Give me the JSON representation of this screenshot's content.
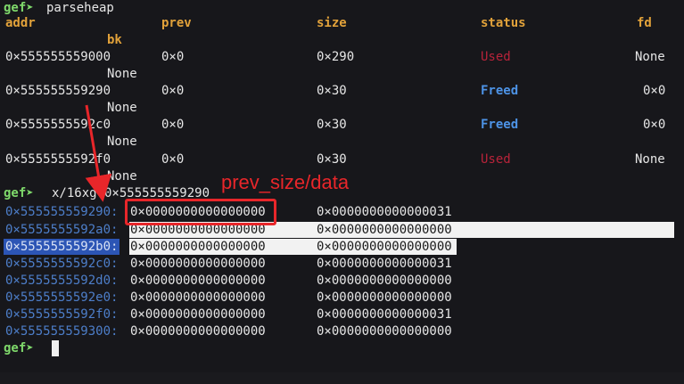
{
  "prompt": "gef➤",
  "commands": {
    "parseheap": "parseheap",
    "examine": "x/16xg 0×555555559290"
  },
  "heap_table": {
    "headers": {
      "addr": "addr",
      "prev": "prev",
      "size": "size",
      "status": "status",
      "fd": "fd",
      "bk": "bk"
    },
    "rows": [
      {
        "addr": "0×555555559000",
        "prev": "0×0",
        "size": "0×290",
        "status": "Used",
        "fd": "None",
        "bk": "None"
      },
      {
        "addr": "0×555555559290",
        "prev": "0×0",
        "size": "0×30",
        "status": "Freed",
        "fd": "0×0",
        "bk": "None"
      },
      {
        "addr": "0×5555555592c0",
        "prev": "0×0",
        "size": "0×30",
        "status": "Freed",
        "fd": "0×0",
        "bk": "None"
      },
      {
        "addr": "0×5555555592f0",
        "prev": "0×0",
        "size": "0×30",
        "status": "Used",
        "fd": "None",
        "bk": "None"
      }
    ]
  },
  "memory_dump": [
    {
      "addr": "0×555555559290:",
      "v1": "0×0000000000000000",
      "v2": "0×0000000000000031"
    },
    {
      "addr": "0×5555555592a0:",
      "v1": "0×0000000000000000",
      "v2": "0×0000000000000000"
    },
    {
      "addr": "0×5555555592b0:",
      "v1": "0×0000000000000000",
      "v2": "0×0000000000000000"
    },
    {
      "addr": "0×5555555592c0:",
      "v1": "0×0000000000000000",
      "v2": "0×0000000000000031"
    },
    {
      "addr": "0×5555555592d0:",
      "v1": "0×0000000000000000",
      "v2": "0×0000000000000000"
    },
    {
      "addr": "0×5555555592e0:",
      "v1": "0×0000000000000000",
      "v2": "0×0000000000000000"
    },
    {
      "addr": "0×5555555592f0:",
      "v1": "0×0000000000000000",
      "v2": "0×0000000000000031"
    },
    {
      "addr": "0×555555559300:",
      "v1": "0×0000000000000000",
      "v2": "0×0000000000000000"
    }
  ],
  "annotation": {
    "label": "prev_size/data"
  },
  "colors": {
    "prompt": "#7fd96b",
    "header": "#e2a23a",
    "used": "#b8233a",
    "freed": "#4d93e6",
    "annotation": "#e8262a"
  }
}
